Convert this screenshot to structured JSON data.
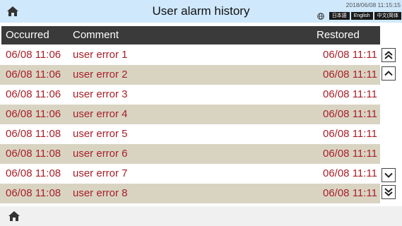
{
  "header": {
    "title": "User alarm history",
    "datetime": "2018/06/08 11:15:15",
    "home_icon": "home-icon",
    "globe_icon": "globe-icon",
    "languages": [
      "日本語",
      "English",
      "中文(简体"
    ]
  },
  "table": {
    "columns": {
      "occurred": "Occurred",
      "comment": "Comment",
      "restored": "Restored"
    },
    "rows": [
      {
        "occurred": "06/08 11:06",
        "comment": "user error 1",
        "restored": "06/08 11:11"
      },
      {
        "occurred": "06/08 11:06",
        "comment": "user error 2",
        "restored": "06/08 11:11"
      },
      {
        "occurred": "06/08 11:06",
        "comment": "user error 3",
        "restored": "06/08 11:11"
      },
      {
        "occurred": "06/08 11:06",
        "comment": "user error 4",
        "restored": "06/08 11:11"
      },
      {
        "occurred": "06/08 11:08",
        "comment": "user error 5",
        "restored": "06/08 11:11"
      },
      {
        "occurred": "06/08 11:08",
        "comment": "user error 6",
        "restored": "06/08 11:11"
      },
      {
        "occurred": "06/08 11:08",
        "comment": "user error 7",
        "restored": "06/08 11:11"
      },
      {
        "occurred": "06/08 11:08",
        "comment": "user error 8",
        "restored": "06/08 11:11"
      }
    ]
  },
  "scroll": {
    "page_up_icon": "double-chevron-up-icon",
    "line_up_icon": "chevron-up-icon",
    "line_down_icon": "chevron-down-icon",
    "page_down_icon": "double-chevron-down-icon"
  },
  "footer": {
    "home_icon": "home-icon"
  },
  "colors": {
    "titlebar": "#cfe8fb",
    "header_bg": "#3a3a3a",
    "row_alt": "#d9d4c2",
    "alarm_text": "#a8202a",
    "footer_bg": "#f0f0f0"
  }
}
